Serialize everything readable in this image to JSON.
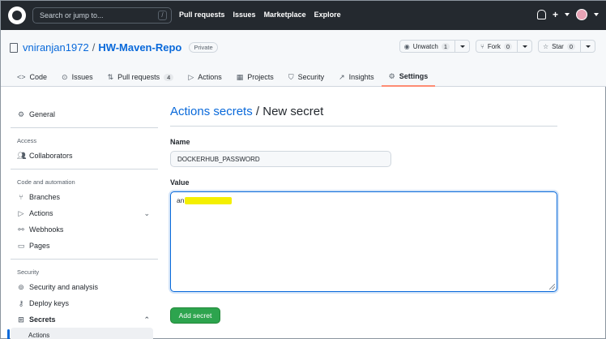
{
  "header": {
    "search_placeholder": "Search or jump to...",
    "search_shortcut": "/",
    "nav": [
      "Pull requests",
      "Issues",
      "Marketplace",
      "Explore"
    ],
    "plus_label": "+"
  },
  "repo": {
    "owner": "vniranjan1972",
    "separator": "/",
    "name": "HW-Maven-Repo",
    "visibility": "Private",
    "watch_label": "Unwatch",
    "watch_count": "1",
    "fork_label": "Fork",
    "fork_count": "0",
    "star_label": "Star",
    "star_count": "0"
  },
  "tabs": [
    {
      "label": "Code",
      "icon": "code-icon"
    },
    {
      "label": "Issues",
      "icon": "issue-icon"
    },
    {
      "label": "Pull requests",
      "icon": "pull-request-icon",
      "count": "4"
    },
    {
      "label": "Actions",
      "icon": "play-icon"
    },
    {
      "label": "Projects",
      "icon": "table-icon"
    },
    {
      "label": "Security",
      "icon": "shield-icon"
    },
    {
      "label": "Insights",
      "icon": "graph-icon"
    },
    {
      "label": "Settings",
      "icon": "gear-icon",
      "active": true
    }
  ],
  "sidebar": {
    "general": "General",
    "access_heading": "Access",
    "collaborators": "Collaborators",
    "code_heading": "Code and automation",
    "branches": "Branches",
    "actions": "Actions",
    "webhooks": "Webhooks",
    "pages": "Pages",
    "security_heading": "Security",
    "security_analysis": "Security and analysis",
    "deploy_keys": "Deploy keys",
    "secrets": "Secrets",
    "secrets_actions": "Actions"
  },
  "main": {
    "breadcrumb_link": "Actions secrets",
    "breadcrumb_sep": " / ",
    "title": "New secret",
    "name_label": "Name",
    "name_value": "DOCKERHUB_PASSWORD",
    "value_label": "Value",
    "value_visible_prefix": "an",
    "submit_label": "Add secret"
  },
  "colors": {
    "header_bg": "#24292f",
    "link": "#0969da",
    "primary_button": "#2da44e",
    "active_tab_underline": "#fd8c73",
    "redaction": "#f4ef00"
  }
}
